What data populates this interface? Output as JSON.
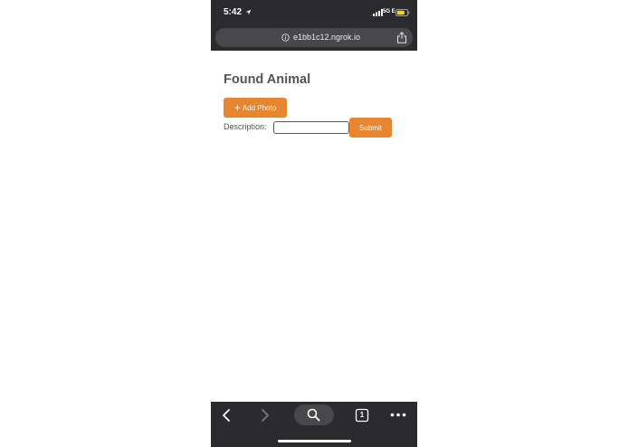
{
  "status_bar": {
    "time": "5:42",
    "network": "5G E",
    "icons": [
      "location-arrow-icon",
      "signal-icon",
      "battery-icon"
    ]
  },
  "address_bar": {
    "url": "e1bb1c12.ngrok.io",
    "icons": [
      "info-icon",
      "share-icon"
    ]
  },
  "page": {
    "title": "Found Animal",
    "add_photo_label": "Add Photo",
    "description_label": "Description:",
    "description_value": "",
    "submit_label": "Submit"
  },
  "toolbar": {
    "tab_count": "1",
    "icons": [
      "back-icon",
      "forward-icon",
      "search-icon",
      "tabs-icon",
      "more-icon"
    ]
  },
  "colors": {
    "accent": "#e8852f",
    "chrome": "#2b2b2d",
    "chrome_pill": "#48484a",
    "text": "#555555"
  }
}
